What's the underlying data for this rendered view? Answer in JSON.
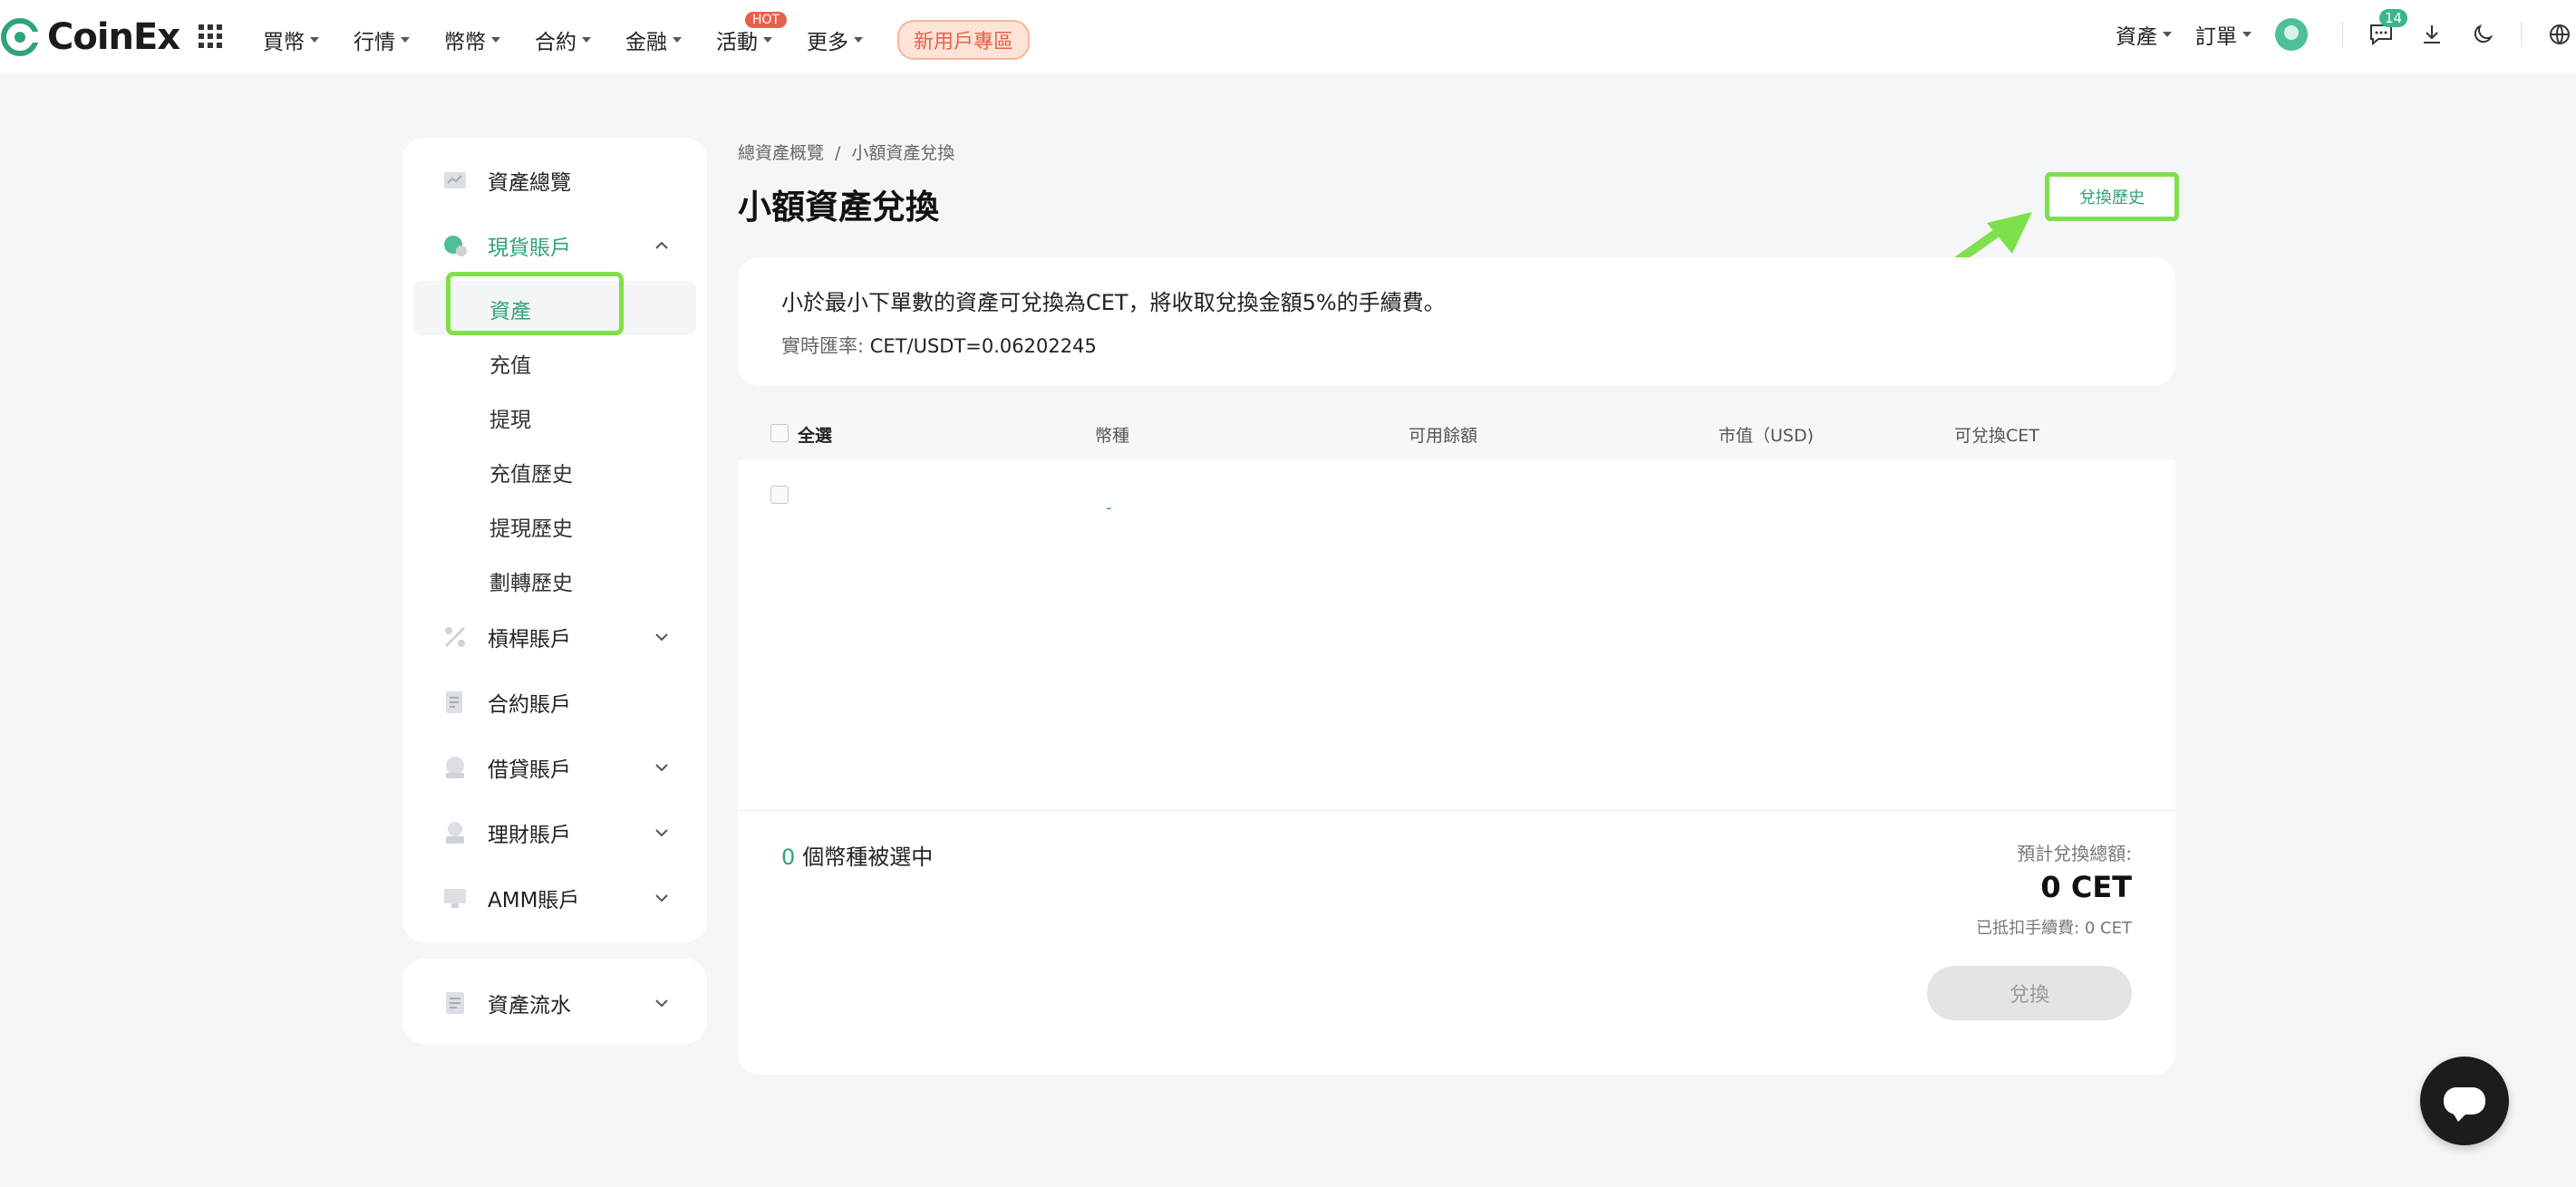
{
  "brand": {
    "name": "CoinEx",
    "accent": "#2fa37b",
    "highlight": "#7ee04a"
  },
  "nav": {
    "items": [
      {
        "label": "買幣",
        "icon": "caret-down-icon"
      },
      {
        "label": "行情",
        "icon": "caret-down-icon"
      },
      {
        "label": "幣幣",
        "icon": "caret-down-icon"
      },
      {
        "label": "合約",
        "icon": "caret-down-icon"
      },
      {
        "label": "金融",
        "icon": "caret-down-icon"
      },
      {
        "label": "活動",
        "icon": "caret-down-icon",
        "badge": "HOT"
      },
      {
        "label": "更多",
        "icon": "caret-down-icon"
      }
    ],
    "new_user": "新用戶專區",
    "right": {
      "assets": "資產",
      "orders": "訂單",
      "messages_count": "14"
    }
  },
  "sidebar": {
    "overview": "資產總覽",
    "spot": "現貨賬戶",
    "spot_sub": [
      "資產",
      "充值",
      "提現",
      "充值歷史",
      "提現歷史",
      "劃轉歷史"
    ],
    "margin": "槓桿賬戶",
    "futures": "合約賬戶",
    "loan": "借貸賬戶",
    "finance": "理財賬戶",
    "amm": "AMM賬戶",
    "flow": "資產流水"
  },
  "main": {
    "breadcrumb": [
      "總資產概覽",
      "小額資產兌換"
    ],
    "breadcrumb_sep": "/",
    "title": "小額資產兌換",
    "history_button": "兌換歷史",
    "info_text": "小於最小下單數的資產可兌換為CET，將收取兌換金額5%的手續費。",
    "rate_label": "實時匯率:",
    "rate_value": "CET/USDT=0.06202245",
    "table": {
      "select_all": "全選",
      "columns": [
        "幣種",
        "可用餘額",
        "市值（USD)",
        "可兌換CET"
      ],
      "row_placeholder": "-"
    },
    "selected_count": "0",
    "selected_suffix": "個幣種被選中",
    "estimate_label": "預計兌換總額:",
    "estimate_value": "0 CET",
    "fee_line": "已抵扣手續費: 0 CET",
    "convert_button": "兌換"
  }
}
